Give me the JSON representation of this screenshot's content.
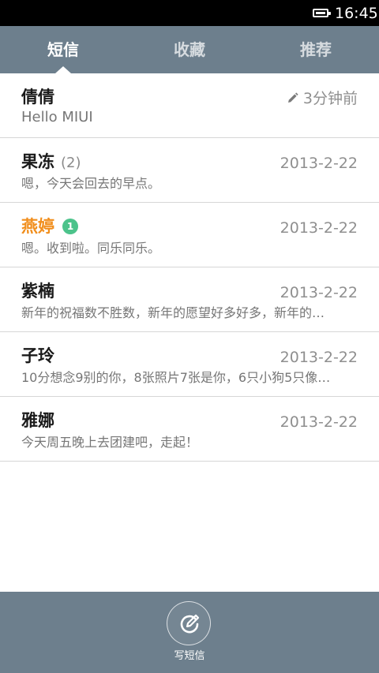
{
  "status_bar": {
    "time": "16:45"
  },
  "tabs": [
    {
      "label": "短信",
      "active": true
    },
    {
      "label": "收藏",
      "active": false
    },
    {
      "label": "推荐",
      "active": false
    }
  ],
  "conversations": [
    {
      "name": "倩倩",
      "count": "",
      "unread_badge": "",
      "date": "3分钟前",
      "draft": true,
      "preview": "Hello MIUI"
    },
    {
      "name": "果冻",
      "count": "(2)",
      "unread_badge": "",
      "date": "2013-2-22",
      "draft": false,
      "preview": "嗯，今天会回去的早点。"
    },
    {
      "name": "燕婷",
      "count": "",
      "unread_badge": "1",
      "date": "2013-2-22",
      "draft": false,
      "preview": "嗯。收到啦。同乐同乐。"
    },
    {
      "name": "紫楠",
      "count": "",
      "unread_badge": "",
      "date": "2013-2-22",
      "draft": false,
      "preview": "新年的祝福数不胜数，新年的愿望好多好多，新年的…"
    },
    {
      "name": "子玲",
      "count": "",
      "unread_badge": "",
      "date": "2013-2-22",
      "draft": false,
      "preview": "10分想念9别的你，8张照片7张是你，6只小狗5只像…"
    },
    {
      "name": "雅娜",
      "count": "",
      "unread_badge": "",
      "date": "2013-2-22",
      "draft": false,
      "preview": "今天周五晚上去团建吧，走起！"
    }
  ],
  "bottom_bar": {
    "compose_label": "写短信"
  },
  "colors": {
    "bar": "#6d7f8d",
    "unread_name": "#f18e1c",
    "badge": "#4cc38b"
  },
  "icons": {
    "battery": "battery-icon",
    "draft": "pencil-icon",
    "compose": "compose-icon"
  }
}
